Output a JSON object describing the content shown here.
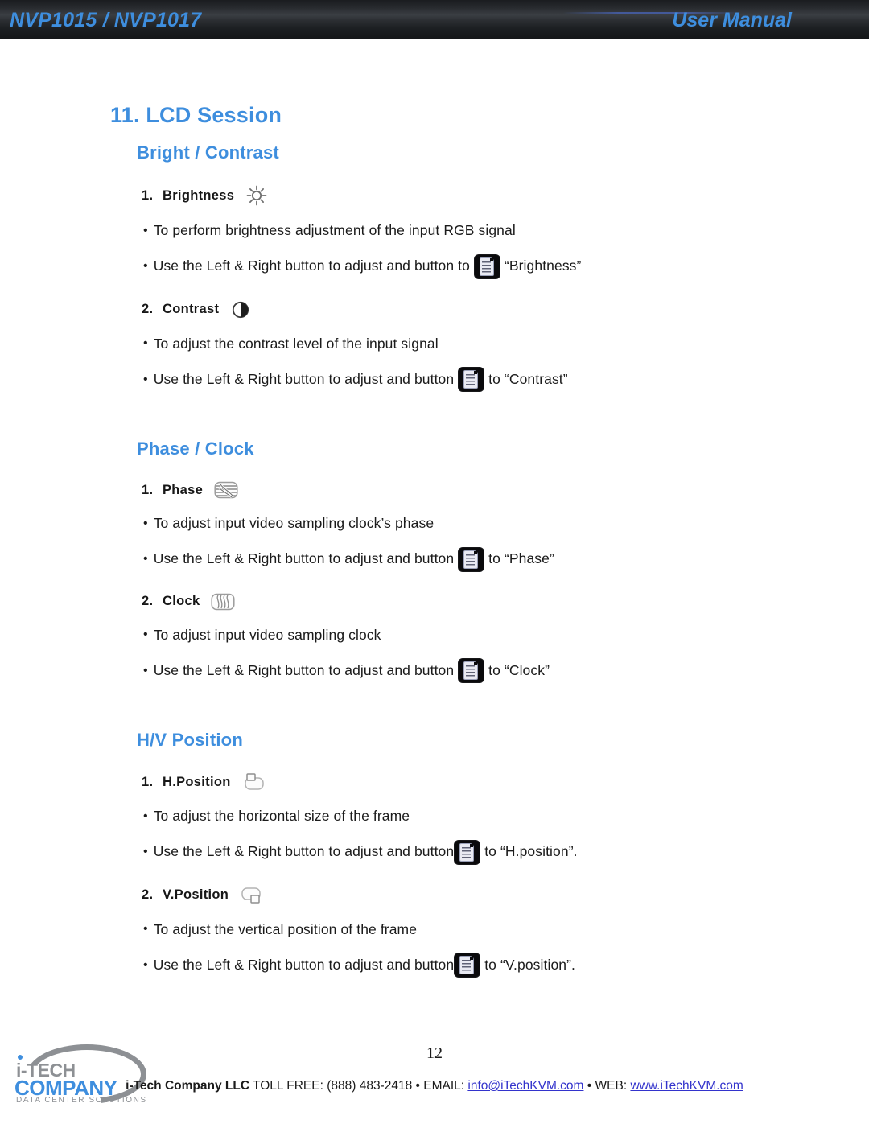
{
  "header": {
    "left_title": "NVP1015 / NVP1017",
    "right_title": "User Manual"
  },
  "main": {
    "chapter_title": "11. LCD Session",
    "sections": [
      {
        "heading": "Bright / Contrast",
        "items": [
          {
            "number": "1.",
            "label": "Brightness",
            "icon": "brightness-sun-icon",
            "bullets": [
              {
                "before": "To perform brightness adjustment of the input RGB signal",
                "button": false,
                "after": ""
              },
              {
                "before": "Use the Left & Right button to adjust and button to ",
                "button": true,
                "after": " “Brightness”"
              }
            ]
          },
          {
            "number": "2.",
            "label": "Contrast",
            "icon": "contrast-half-circle-icon",
            "bullets": [
              {
                "before": "To adjust the contrast level of the input signal",
                "button": false,
                "after": ""
              },
              {
                "before": "Use the Left & Right button to adjust and button ",
                "button": true,
                "after": " to “Contrast”"
              }
            ]
          }
        ]
      },
      {
        "heading": "Phase / Clock",
        "items": [
          {
            "number": "1.",
            "label": "Phase",
            "icon": "phase-horizontal-waves-icon",
            "bullets": [
              {
                "before": "To adjust input video sampling clock’s phase",
                "button": false,
                "after": ""
              },
              {
                "before": "Use the Left & Right button to adjust and button ",
                "button": true,
                "after": " to “Phase”"
              }
            ]
          },
          {
            "number": "2.",
            "label": "Clock",
            "icon": "clock-vertical-waves-icon",
            "bullets": [
              {
                "before": "To adjust input video sampling clock",
                "button": false,
                "after": ""
              },
              {
                "before": "Use the Left & Right button to adjust and button ",
                "button": true,
                "after": " to “Clock”"
              }
            ]
          }
        ]
      },
      {
        "heading": "H/V Position",
        "items": [
          {
            "number": "1.",
            "label": "H.Position",
            "icon": "h-position-icon",
            "bullets": [
              {
                "before": "To adjust the horizontal size of the frame",
                "button": false,
                "after": ""
              },
              {
                "before": "Use the Left & Right button to adjust and button",
                "button": true,
                "after": " to “H.position”."
              }
            ]
          },
          {
            "number": "2.",
            "label": "V.Position",
            "icon": "v-position-icon",
            "bullets": [
              {
                "before": "To adjust the vertical position of the frame",
                "button": false,
                "after": ""
              },
              {
                "before": "Use the Left & Right button to adjust and button",
                "button": true,
                "after": " to “V.position”."
              }
            ]
          }
        ]
      }
    ],
    "bullet_glyph": "•",
    "inline_button_icon": "lcd-menu-button-icon"
  },
  "footer": {
    "logo": {
      "line1": "i-TECH",
      "line2": "COMPANY",
      "line3": "DATA CENTER SOLUTIONS"
    },
    "page_number": "12",
    "company": "i-Tech Company LLC",
    "toll_free": " TOLL FREE: (888) 483-2418 • EMAIL: ",
    "email": "info@iTechKVM.com",
    "web_label": " • WEB: ",
    "web": "www.iTechKVM.com"
  },
  "colors": {
    "accent_blue": "#3e8ede",
    "link_blue": "#3333cc",
    "logo_gray": "#8d9094",
    "header_dark": "#1a1c1f"
  }
}
